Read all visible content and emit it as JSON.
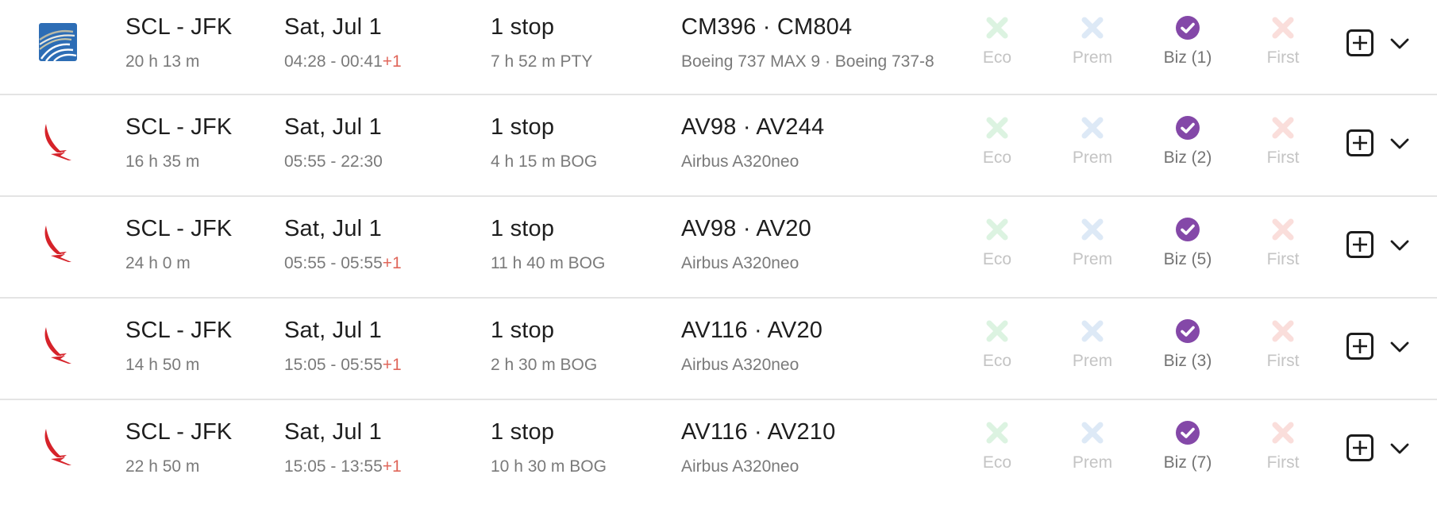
{
  "colors": {
    "eco_unavailable": "#dcf3e1",
    "prem_unavailable": "#dde9f6",
    "biz_available": "#8448a8",
    "first_unavailable": "#fadedb",
    "next_day": "#e0675b"
  },
  "flights": [
    {
      "airline_logo": "copa-airlines-logo",
      "route": "SCL - JFK",
      "duration": "20 h 13 m",
      "date": "Sat, Jul 1",
      "times": "04:28 - 00:41",
      "next_day": "+1",
      "stops": "1 stop",
      "layover": "7 h 52 m  PTY",
      "flight_numbers": "CM396  ·  CM804",
      "aircraft": "Boeing 737 MAX 9  ·  Boeing 737-8",
      "cabins": {
        "eco": {
          "label": "Eco",
          "available": false
        },
        "prem": {
          "label": "Prem",
          "available": false
        },
        "biz": {
          "label": "Biz (1)",
          "available": true
        },
        "first": {
          "label": "First",
          "available": false
        }
      }
    },
    {
      "airline_logo": "avianca-logo",
      "route": "SCL - JFK",
      "duration": "16 h 35 m",
      "date": "Sat, Jul 1",
      "times": "05:55 - 22:30",
      "next_day": "",
      "stops": "1 stop",
      "layover": "4 h 15 m  BOG",
      "flight_numbers": "AV98  ·  AV244",
      "aircraft": "Airbus A320neo",
      "cabins": {
        "eco": {
          "label": "Eco",
          "available": false
        },
        "prem": {
          "label": "Prem",
          "available": false
        },
        "biz": {
          "label": "Biz (2)",
          "available": true
        },
        "first": {
          "label": "First",
          "available": false
        }
      }
    },
    {
      "airline_logo": "avianca-logo",
      "route": "SCL - JFK",
      "duration": "24 h 0 m",
      "date": "Sat, Jul 1",
      "times": "05:55 - 05:55",
      "next_day": "+1",
      "stops": "1 stop",
      "layover": "11 h 40 m  BOG",
      "flight_numbers": "AV98  ·  AV20",
      "aircraft": "Airbus A320neo",
      "cabins": {
        "eco": {
          "label": "Eco",
          "available": false
        },
        "prem": {
          "label": "Prem",
          "available": false
        },
        "biz": {
          "label": "Biz (5)",
          "available": true
        },
        "first": {
          "label": "First",
          "available": false
        }
      }
    },
    {
      "airline_logo": "avianca-logo",
      "route": "SCL - JFK",
      "duration": "14 h 50 m",
      "date": "Sat, Jul 1",
      "times": "15:05 - 05:55",
      "next_day": "+1",
      "stops": "1 stop",
      "layover": "2 h 30 m  BOG",
      "flight_numbers": "AV116  ·  AV20",
      "aircraft": "Airbus A320neo",
      "cabins": {
        "eco": {
          "label": "Eco",
          "available": false
        },
        "prem": {
          "label": "Prem",
          "available": false
        },
        "biz": {
          "label": "Biz (3)",
          "available": true
        },
        "first": {
          "label": "First",
          "available": false
        }
      }
    },
    {
      "airline_logo": "avianca-logo",
      "route": "SCL - JFK",
      "duration": "22 h 50 m",
      "date": "Sat, Jul 1",
      "times": "15:05 - 13:55",
      "next_day": "+1",
      "stops": "1 stop",
      "layover": "10 h 30 m  BOG",
      "flight_numbers": "AV116  ·  AV210",
      "aircraft": "Airbus A320neo",
      "cabins": {
        "eco": {
          "label": "Eco",
          "available": false
        },
        "prem": {
          "label": "Prem",
          "available": false
        },
        "biz": {
          "label": "Biz (7)",
          "available": true
        },
        "first": {
          "label": "First",
          "available": false
        }
      }
    }
  ]
}
